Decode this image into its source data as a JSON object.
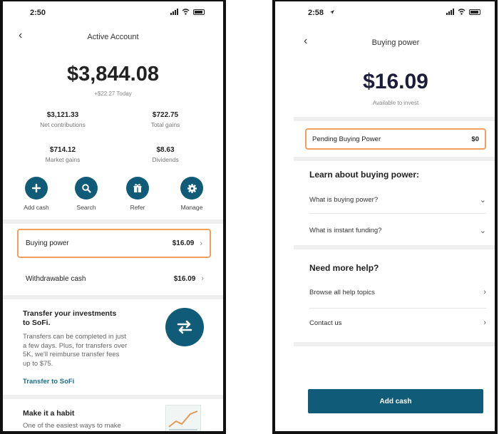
{
  "left": {
    "status_time": "2:50",
    "nav_title": "Active Account",
    "balance": "$3,844.08",
    "today_change": "+$22.27 Today",
    "stats": [
      {
        "value": "$3,121.33",
        "label": "Net contributions"
      },
      {
        "value": "$722.75",
        "label": "Total gains"
      },
      {
        "value": "$714.12",
        "label": "Market gains"
      },
      {
        "value": "$8.63",
        "label": "Dividends"
      }
    ],
    "actions": [
      {
        "label": "Add cash",
        "icon": "plus-icon"
      },
      {
        "label": "Search",
        "icon": "search-icon"
      },
      {
        "label": "Refer",
        "icon": "gift-icon"
      },
      {
        "label": "Manage",
        "icon": "gear-icon"
      }
    ],
    "rows": [
      {
        "label": "Buying power",
        "amount": "$16.09"
      },
      {
        "label": "Withdrawable cash",
        "amount": "$16.09"
      }
    ],
    "promo": {
      "title_line1": "Transfer your investments",
      "title_line2": "to SoFi.",
      "body_lines": [
        "Transfers can be completed in just",
        "a few days. Plus, for transfers over",
        "5K, we'll reimburse transfer fees",
        "up to $75."
      ],
      "link": "Transfer to SoFi"
    },
    "habit": {
      "title": "Make it a habit",
      "body": "One of the easiest ways to make"
    }
  },
  "right": {
    "status_time": "2:58",
    "nav_title": "Buying power",
    "amount": "$16.09",
    "amount_caption": "Available to invest",
    "pending": {
      "label": "Pending Buying Power",
      "amount": "$0"
    },
    "learn_heading": "Learn about buying power:",
    "faqs": [
      "What is buying power?",
      "What is instant funding?"
    ],
    "help_heading": "Need more help?",
    "help_links": [
      "Browse all help topics",
      "Contact us"
    ],
    "button": "Add cash"
  },
  "colors": {
    "accent": "#0f5b78",
    "highlight": "#f0a05a"
  }
}
